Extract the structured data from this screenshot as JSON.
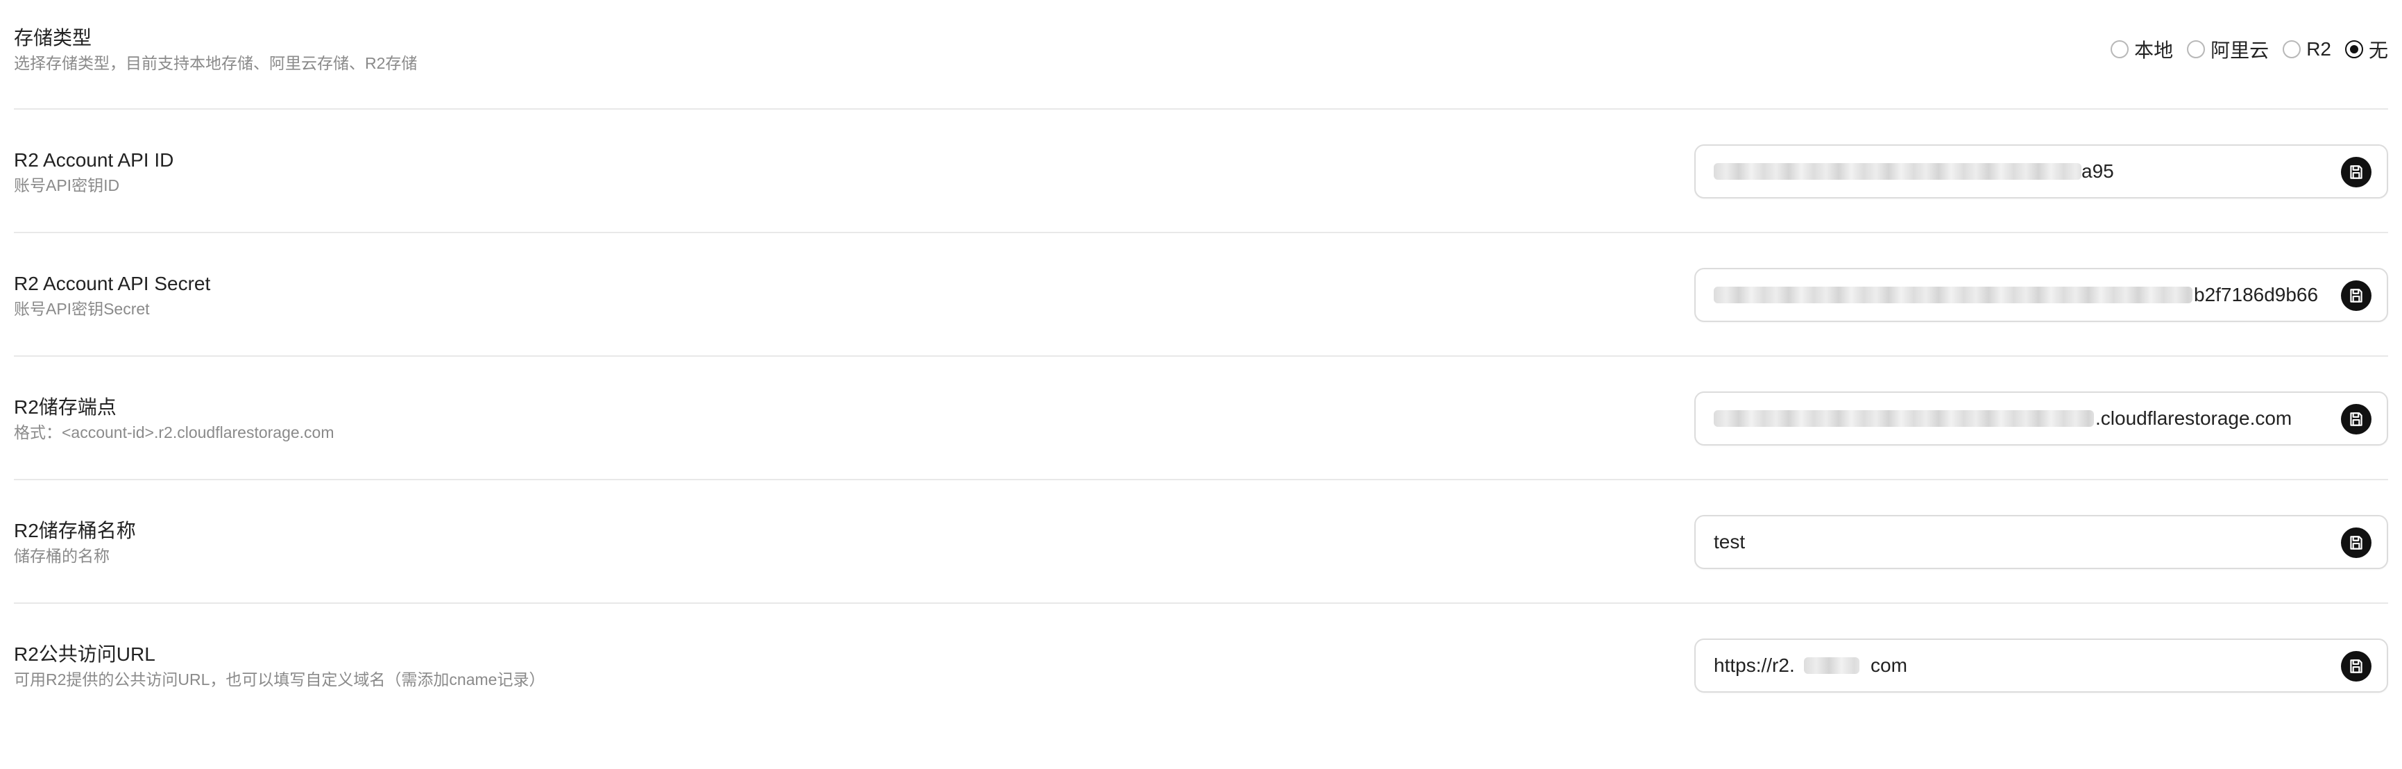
{
  "storage_type": {
    "title": "存储类型",
    "description": "选择存储类型，目前支持本地存储、阿里云存储、R2存储",
    "options": [
      {
        "label": "本地",
        "selected": false
      },
      {
        "label": "阿里云",
        "selected": false
      },
      {
        "label": "R2",
        "selected": false
      },
      {
        "label": "无",
        "selected": true
      }
    ]
  },
  "fields": [
    {
      "title": "R2 Account API ID",
      "description": "账号API密钥ID",
      "value_visible": "a95",
      "save_icon": "save-icon"
    },
    {
      "title": "R2 Account API Secret",
      "description": "账号API密钥Secret",
      "value_visible": "b2f7186d9b66",
      "save_icon": "save-icon"
    },
    {
      "title": "R2储存端点",
      "description": "格式：<account-id>.r2.cloudflarestorage.com",
      "value_visible": ".cloudflarestorage.com",
      "save_icon": "save-icon"
    },
    {
      "title": "R2储存桶名称",
      "description": "储存桶的名称",
      "value_visible": "test",
      "save_icon": "save-icon"
    },
    {
      "title": "R2公共访问URL",
      "description": "可用R2提供的公共访问URL，也可以填写自定义域名（需添加cname记录）",
      "value_prefix": "https://r2.",
      "value_suffix": "com",
      "save_icon": "save-icon"
    }
  ],
  "colors": {
    "accent": "#111111",
    "border": "#dcdcdc",
    "divider": "#e8e8e8",
    "muted_text": "#8a8a8a"
  }
}
